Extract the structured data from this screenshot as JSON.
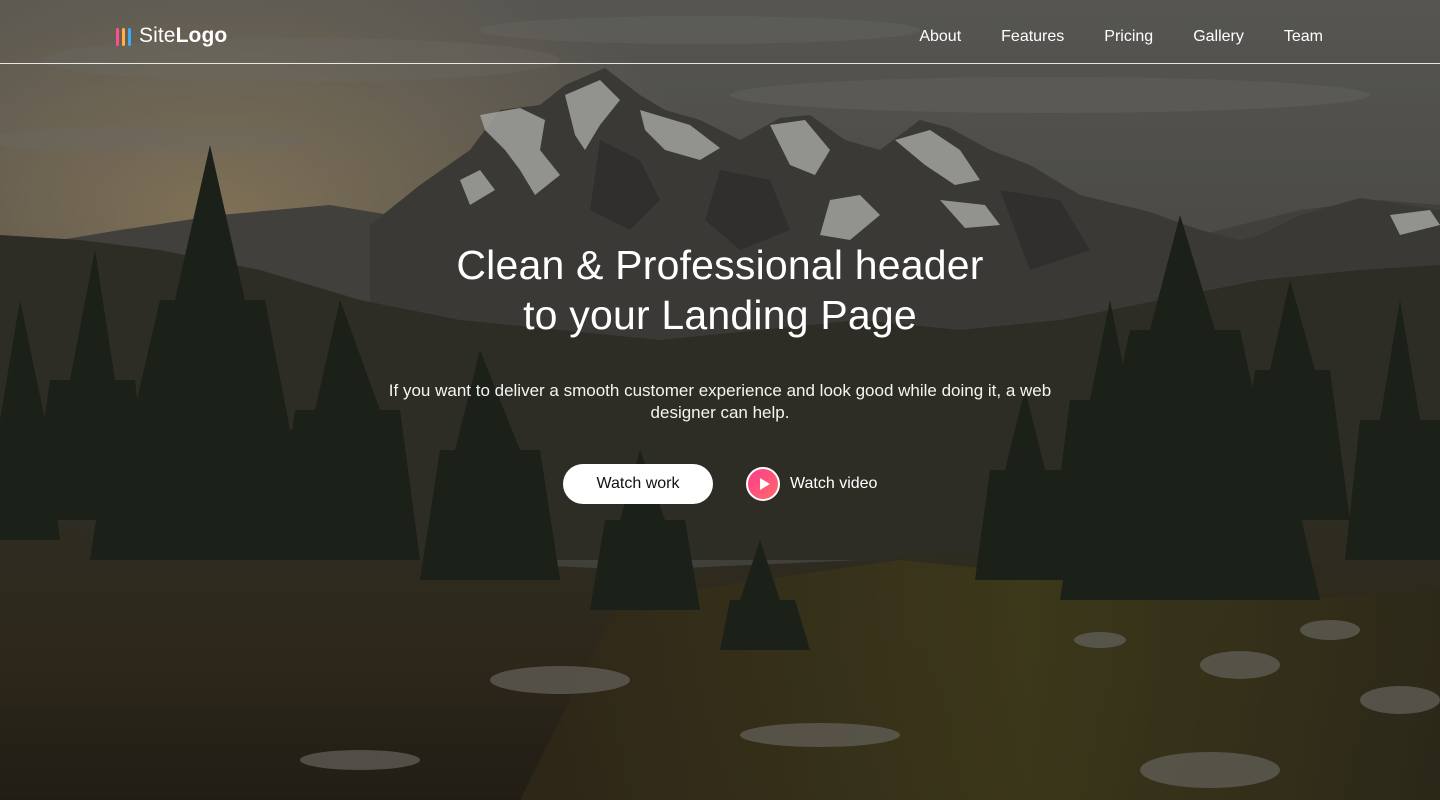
{
  "brand": {
    "logo_light": "Site",
    "logo_bold": "Logo",
    "mark_colors": [
      "#ff4f8b",
      "#ffb23f",
      "#3fa9f5"
    ]
  },
  "nav": {
    "items": [
      {
        "label": "About"
      },
      {
        "label": "Features"
      },
      {
        "label": "Pricing"
      },
      {
        "label": "Gallery"
      },
      {
        "label": "Team"
      }
    ]
  },
  "hero": {
    "headline_line1": "Clean & Professional header",
    "headline_line2": "to your Landing Page",
    "subtext": "If you want to deliver a smooth customer experience and look good while doing it, a web designer can help.",
    "primary_cta": "Watch work",
    "video_cta": "Watch video",
    "play_icon": "play-icon",
    "accent_color": "#ff4f8b"
  }
}
